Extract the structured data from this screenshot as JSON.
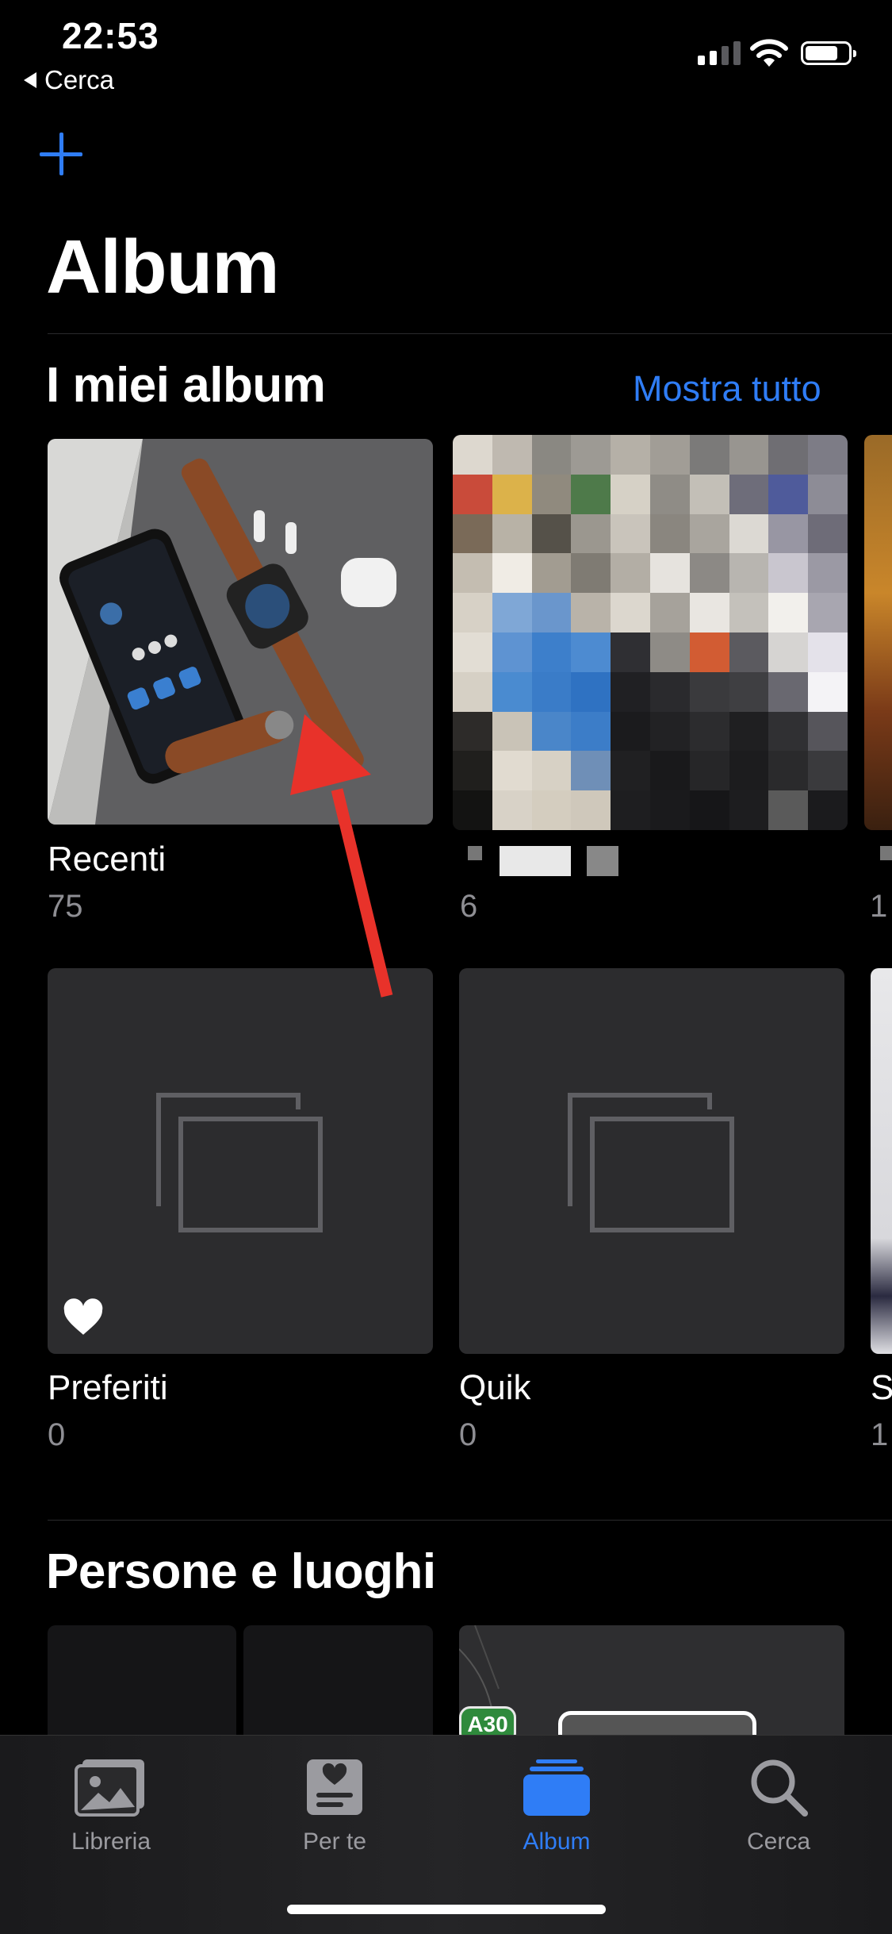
{
  "status_bar": {
    "time": "22:53",
    "back_label": "Cerca"
  },
  "header": {
    "title": "Album"
  },
  "my_albums": {
    "title": "I miei album",
    "show_all": "Mostra tutto",
    "albums": [
      {
        "name": "Recenti",
        "count": "75"
      },
      {
        "name": "",
        "count": "6"
      },
      {
        "name": "",
        "count": "1"
      },
      {
        "name": "Preferiti",
        "count": "0"
      },
      {
        "name": "Quik",
        "count": "0"
      },
      {
        "name": "S",
        "count": "1"
      }
    ]
  },
  "people_places": {
    "title": "Persone e luoghi",
    "map_label": "A30"
  },
  "tabs": [
    {
      "label": "Libreria",
      "icon": "photo-library-icon"
    },
    {
      "label": "Per te",
      "icon": "for-you-icon"
    },
    {
      "label": "Album",
      "icon": "album-stack-icon",
      "active": true
    },
    {
      "label": "Cerca",
      "icon": "search-icon"
    }
  ],
  "colors": {
    "accent": "#2f7df6",
    "background": "#000000",
    "secondary_text": "#8e8e93"
  }
}
